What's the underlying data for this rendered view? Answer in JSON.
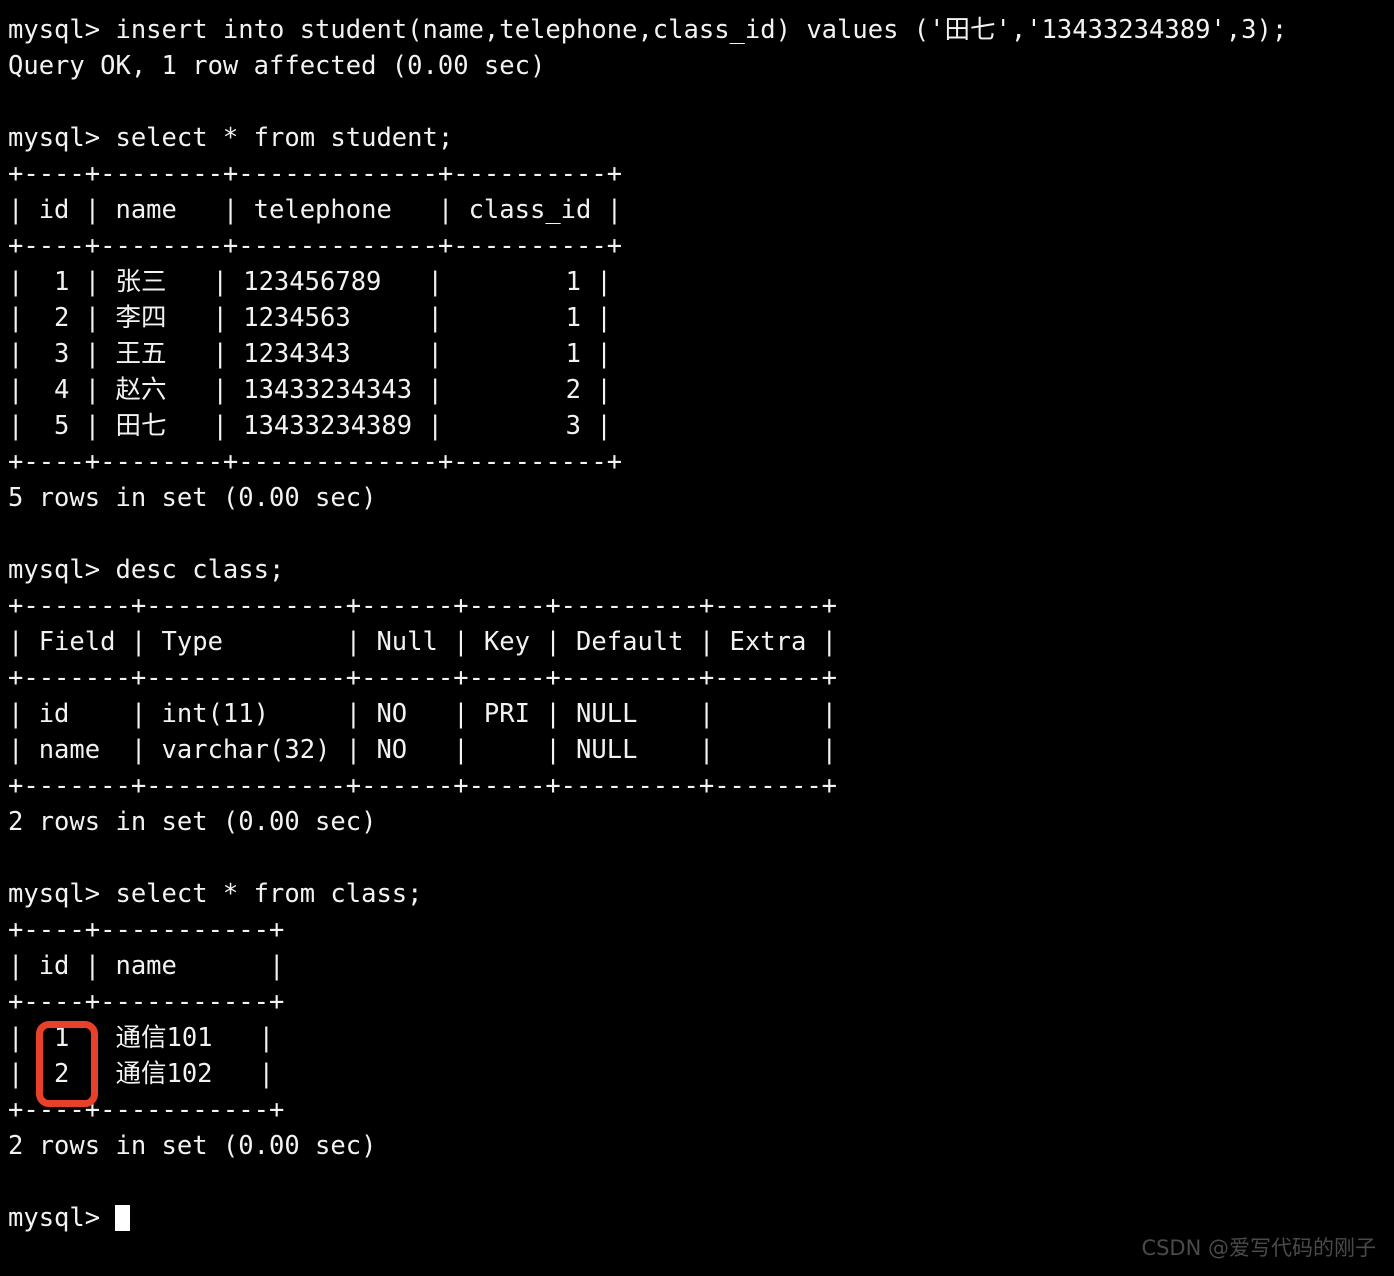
{
  "terminal": {
    "background_color": "#000000",
    "foreground_color": "#f2f2f2",
    "highlight_color": "#e8402a",
    "prompt": "mysql>",
    "lines": [
      "mysql> insert into student(name,telephone,class_id) values ('田七','13433234389',3);",
      "Query OK, 1 row affected (0.00 sec)",
      "",
      "mysql> select * from student;",
      "+----+--------+-------------+----------+",
      "| id | name   | telephone   | class_id |",
      "+----+--------+-------------+----------+",
      "|  1 | 张三   | 123456789   |        1 |",
      "|  2 | 李四   | 1234563     |        1 |",
      "|  3 | 王五   | 1234343     |        1 |",
      "|  4 | 赵六   | 13433234343 |        2 |",
      "|  5 | 田七   | 13433234389 |        3 |",
      "+----+--------+-------------+----------+",
      "5 rows in set (0.00 sec)",
      "",
      "mysql> desc class;",
      "+-------+-------------+------+-----+---------+-------+",
      "| Field | Type        | Null | Key | Default | Extra |",
      "+-------+-------------+------+-----+---------+-------+",
      "| id    | int(11)     | NO   | PRI | NULL    |       |",
      "| name  | varchar(32) | NO   |     | NULL    |       |",
      "+-------+-------------+------+-----+---------+-------+",
      "2 rows in set (0.00 sec)",
      "",
      "mysql> select * from class;",
      "+----+-----------+",
      "| id | name      |",
      "+----+-----------+",
      "|  1 | 通信101   |",
      "|  2 | 通信102   |",
      "+----+-----------+",
      "2 rows in set (0.00 sec)",
      "",
      "mysql> "
    ]
  },
  "tables": {
    "student": {
      "query": "select * from student;",
      "columns": [
        "id",
        "name",
        "telephone",
        "class_id"
      ],
      "rows": [
        [
          "1",
          "张三",
          "123456789",
          "1"
        ],
        [
          "2",
          "李四",
          "1234563",
          "1"
        ],
        [
          "3",
          "王五",
          "1234343",
          "1"
        ],
        [
          "4",
          "赵六",
          "13433234343",
          "2"
        ],
        [
          "5",
          "田七",
          "13433234389",
          "3"
        ]
      ],
      "result_text": "5 rows in set (0.00 sec)"
    },
    "class_desc": {
      "query": "desc class;",
      "columns": [
        "Field",
        "Type",
        "Null",
        "Key",
        "Default",
        "Extra"
      ],
      "rows": [
        [
          "id",
          "int(11)",
          "NO",
          "PRI",
          "NULL",
          ""
        ],
        [
          "name",
          "varchar(32)",
          "NO",
          "",
          "NULL",
          ""
        ]
      ],
      "result_text": "2 rows in set (0.00 sec)"
    },
    "class": {
      "query": "select * from class;",
      "columns": [
        "id",
        "name"
      ],
      "rows": [
        [
          "1",
          "通信101"
        ],
        [
          "2",
          "通信102"
        ]
      ],
      "result_text": "2 rows in set (0.00 sec)"
    }
  },
  "insert_statement": {
    "sql": "insert into student(name,telephone,class_id) values ('田七','13433234389',3);",
    "result_text": "Query OK, 1 row affected (0.00 sec)"
  },
  "annotation": {
    "label": "id-column-highlight",
    "color": "#e8402a",
    "highlighted_values": [
      "1",
      "2"
    ]
  },
  "watermark": {
    "text": "CSDN @爱写代码的刚子"
  }
}
